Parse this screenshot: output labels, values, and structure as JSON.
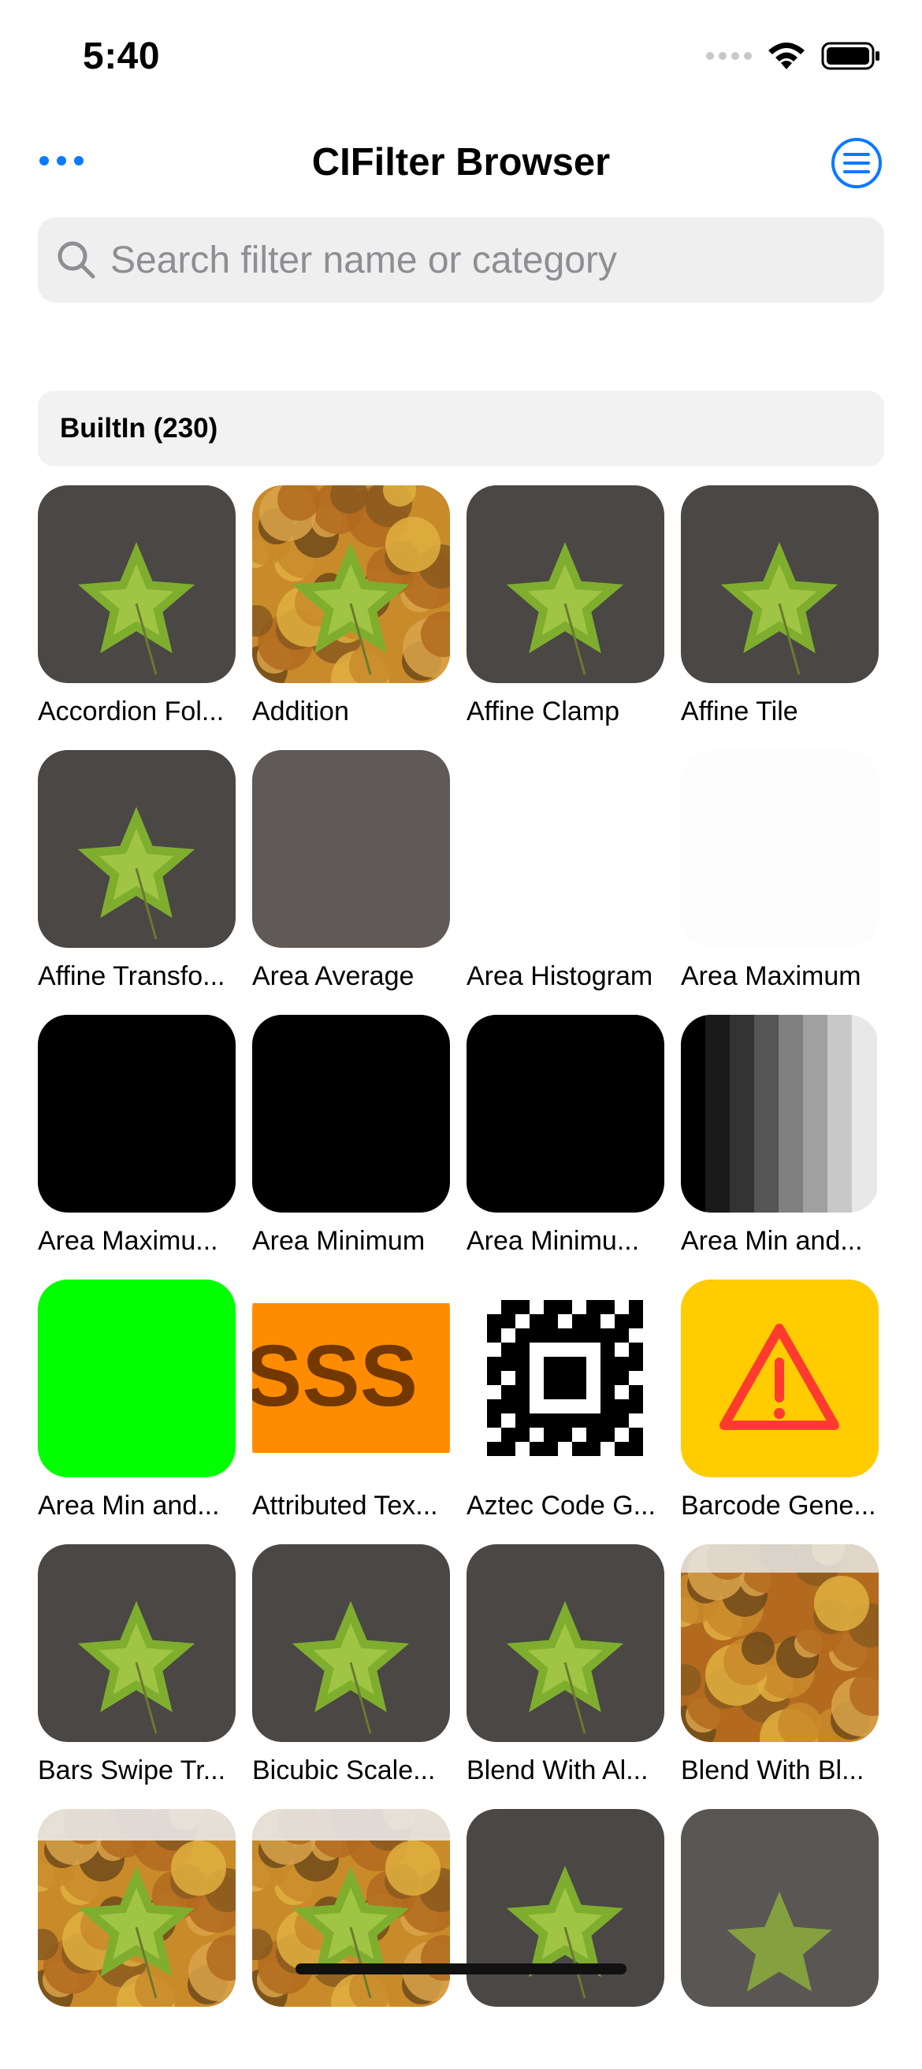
{
  "status_bar": {
    "time": "5:40"
  },
  "nav": {
    "title": "CIFilter Browser"
  },
  "search": {
    "placeholder": "Search filter name or category"
  },
  "section": {
    "title": "BuiltIn (230)"
  },
  "filters": [
    {
      "name": "Accordion Fol...",
      "thumb": "leaf"
    },
    {
      "name": "Addition",
      "thumb": "leaf-autumn"
    },
    {
      "name": "Affine Clamp",
      "thumb": "leaf"
    },
    {
      "name": "Affine Tile",
      "thumb": "leaf"
    },
    {
      "name": "Affine Transfo...",
      "thumb": "leaf"
    },
    {
      "name": "Area Average",
      "thumb": "gray"
    },
    {
      "name": "Area Histogram",
      "thumb": "blank"
    },
    {
      "name": "Area Maximum",
      "thumb": "blank-light"
    },
    {
      "name": "Area Maximu...",
      "thumb": "black"
    },
    {
      "name": "Area Minimum",
      "thumb": "black"
    },
    {
      "name": "Area Minimu...",
      "thumb": "black"
    },
    {
      "name": "Area Min and...",
      "thumb": "gray-bars"
    },
    {
      "name": "Area Min and...",
      "thumb": "green"
    },
    {
      "name": "Attributed Tex...",
      "thumb": "orange-text"
    },
    {
      "name": "Aztec Code G...",
      "thumb": "aztec"
    },
    {
      "name": "Barcode Gene...",
      "thumb": "warning"
    },
    {
      "name": "Bars Swipe Tr...",
      "thumb": "leaf"
    },
    {
      "name": "Bicubic Scale...",
      "thumb": "leaf"
    },
    {
      "name": "Blend With Al...",
      "thumb": "leaf"
    },
    {
      "name": "Blend With Bl...",
      "thumb": "autumn"
    },
    {
      "name": "",
      "thumb": "leaf-autumn-top"
    },
    {
      "name": "",
      "thumb": "leaf-autumn-top"
    },
    {
      "name": "",
      "thumb": "leaf"
    },
    {
      "name": "",
      "thumb": "leaf-blur"
    }
  ],
  "colors": {
    "accent": "#0a7aff",
    "search_bg": "#efeff0",
    "section_bg": "#f2f2f3",
    "asphalt": "#4a4745",
    "area_average_gray": "#5f5a57",
    "green": "#00ff00",
    "warning_yellow": "#ffcc00",
    "warning_red": "#ff3b30",
    "orange": "#ff8c00"
  },
  "icons": {
    "more": "ellipsis-icon",
    "menu": "list-circle-icon",
    "search": "magnifier-icon",
    "wifi": "wifi-icon",
    "battery": "battery-icon",
    "signal": "signal-icon"
  }
}
